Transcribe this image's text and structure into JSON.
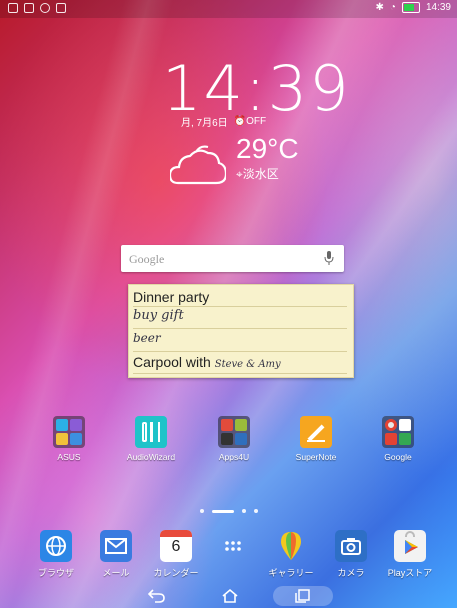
{
  "status_bar": {
    "time": "14:39"
  },
  "lockscreen_clock": {
    "time": "14:39",
    "date": "月, 7月6日",
    "alarm": "OFF"
  },
  "weather": {
    "temperature": "29°C",
    "location": "淡水区"
  },
  "search_widget": {
    "placeholder": "Google"
  },
  "note_widget": {
    "line1": "Dinner party",
    "line2": "buy gift",
    "line3": "beer",
    "line4_print": "Carpool with",
    "line4_hand": "Steve & Amy"
  },
  "apps": [
    {
      "label": "ASUS",
      "icon": "asus-folder-icon"
    },
    {
      "label": "AudioWizard",
      "icon": "audiowizard-icon",
      "color": "#1fc3c9"
    },
    {
      "label": "Apps4U",
      "icon": "apps4u-folder-icon"
    },
    {
      "label": "SuperNote",
      "icon": "supernote-icon",
      "color": "#f6a61f"
    },
    {
      "label": "Google",
      "icon": "google-folder-icon"
    }
  ],
  "dock": [
    {
      "label": "ブラウザ",
      "icon": "browser-icon",
      "color": "#2c86e6"
    },
    {
      "label": "メール",
      "icon": "mail-icon",
      "color": "#3a7be0"
    },
    {
      "label": "カレンダー",
      "icon": "calendar-icon",
      "day": "6"
    },
    {
      "label": "",
      "icon": "all-apps-icon"
    },
    {
      "label": "ギャラリー",
      "icon": "gallery-icon"
    },
    {
      "label": "カメラ",
      "icon": "camera-icon",
      "color": "#2e6fc6"
    },
    {
      "label": "Playストア",
      "icon": "play-store-icon"
    }
  ],
  "page_indicator": {
    "pages": 4,
    "current": 2
  }
}
